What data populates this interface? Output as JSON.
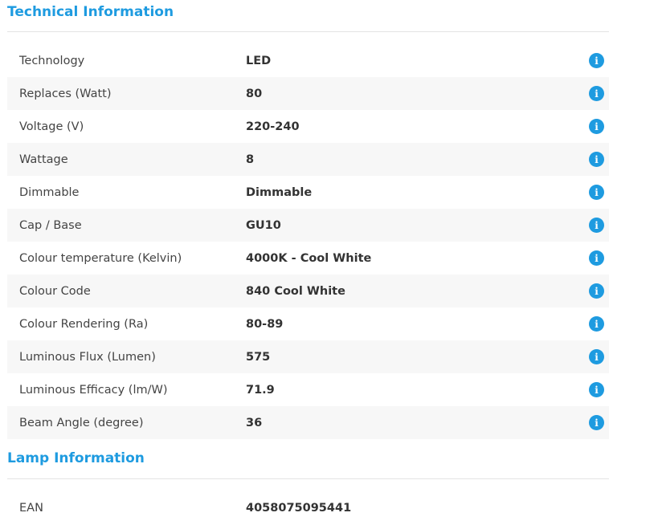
{
  "technical": {
    "title": "Technical Information",
    "rows": [
      {
        "label": "Technology",
        "value": "LED",
        "icon": "info-icon"
      },
      {
        "label": "Replaces (Watt)",
        "value": "80",
        "icon": "info-icon"
      },
      {
        "label": "Voltage (V)",
        "value": "220-240",
        "icon": "info-icon"
      },
      {
        "label": "Wattage",
        "value": "8",
        "icon": "info-icon"
      },
      {
        "label": "Dimmable",
        "value": "Dimmable",
        "icon": "info-icon"
      },
      {
        "label": "Cap / Base",
        "value": "GU10",
        "icon": "info-icon"
      },
      {
        "label": "Colour temperature (Kelvin)",
        "value": "4000K - Cool White",
        "icon": "info-icon"
      },
      {
        "label": "Colour Code",
        "value": "840 Cool White",
        "icon": "info-icon"
      },
      {
        "label": "Colour Rendering (Ra)",
        "value": "80-89",
        "icon": "info-icon"
      },
      {
        "label": "Luminous Flux (Lumen)",
        "value": "575",
        "icon": "info-icon"
      },
      {
        "label": "Luminous Efficacy (lm/W)",
        "value": "71.9",
        "icon": "info-icon"
      },
      {
        "label": "Beam Angle (degree)",
        "value": "36",
        "icon": "info-icon"
      }
    ]
  },
  "lamp": {
    "title": "Lamp Information",
    "rows": [
      {
        "label": "EAN",
        "value": "4058075095441"
      }
    ]
  },
  "colors": {
    "accent": "#1e9be0",
    "row_alt": "#f7f7f7",
    "divider": "#e3e3e3"
  }
}
